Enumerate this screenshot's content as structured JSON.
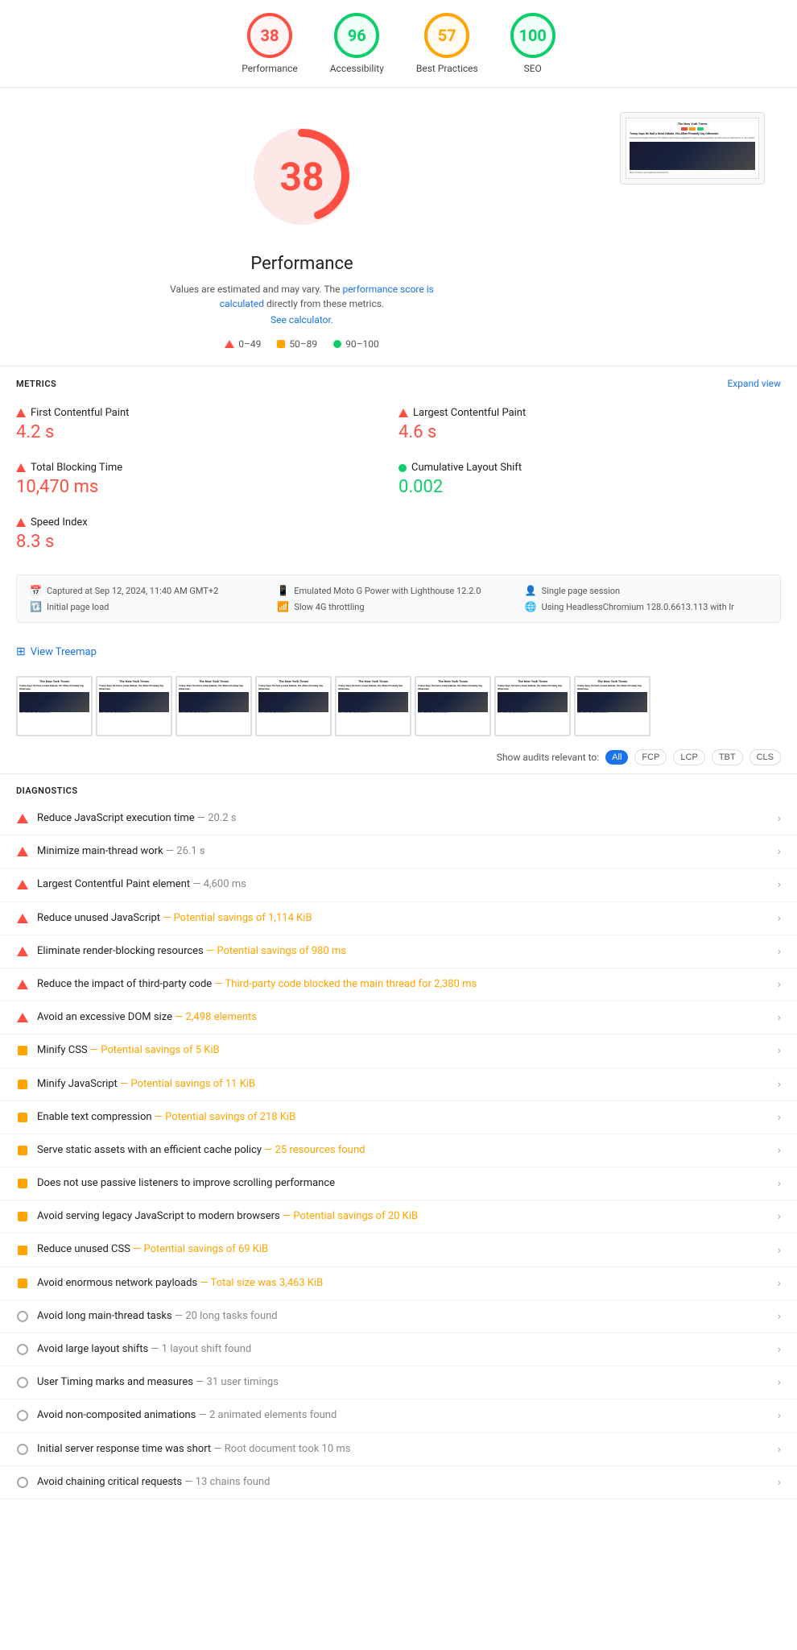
{
  "header": {
    "scores": [
      {
        "id": "performance",
        "value": "38",
        "label": "Performance",
        "colorClass": "red"
      },
      {
        "id": "accessibility",
        "value": "96",
        "label": "Accessibility",
        "colorClass": "green-light"
      },
      {
        "id": "best-practices",
        "value": "57",
        "label": "Best Practices",
        "colorClass": "orange"
      },
      {
        "id": "seo",
        "value": "100",
        "label": "SEO",
        "colorClass": "green"
      }
    ]
  },
  "performance": {
    "score": "38",
    "title": "Performance",
    "description": "Values are estimated and may vary. The",
    "description_link": "performance score is calculated",
    "description_end": "directly from these metrics.",
    "see_calculator": "See calculator.",
    "legend": [
      {
        "type": "triangle",
        "range": "0–49"
      },
      {
        "type": "square",
        "range": "50–89"
      },
      {
        "type": "dot",
        "range": "90–100"
      }
    ]
  },
  "metrics": {
    "title": "METRICS",
    "expand_view": "Expand view",
    "items": [
      {
        "id": "fcp",
        "icon": "triangle",
        "name": "First Contentful Paint",
        "value": "4.2 s",
        "color": "red"
      },
      {
        "id": "lcp",
        "icon": "triangle",
        "name": "Largest Contentful Paint",
        "value": "4.6 s",
        "color": "red"
      },
      {
        "id": "tbt",
        "icon": "triangle",
        "name": "Total Blocking Time",
        "value": "10,470 ms",
        "color": "red"
      },
      {
        "id": "cls",
        "icon": "dot",
        "name": "Cumulative Layout Shift",
        "value": "0.002",
        "color": "green"
      },
      {
        "id": "si",
        "icon": "triangle",
        "name": "Speed Index",
        "value": "8.3 s",
        "color": "red"
      }
    ]
  },
  "info_bar": {
    "items": [
      {
        "icon": "📅",
        "text": "Captured at Sep 12, 2024, 11:40 AM GMT+2"
      },
      {
        "icon": "📱",
        "text": "Emulated Moto G Power with Lighthouse 12.2.0"
      },
      {
        "icon": "👤",
        "text": "Single page session"
      },
      {
        "icon": "🔃",
        "text": "Initial page load"
      },
      {
        "icon": "📶",
        "text": "Slow 4G throttling"
      },
      {
        "icon": "🌐",
        "text": "Using HeadlessChromium 128.0.6613.113 with lr"
      }
    ]
  },
  "treemap": {
    "link": "View Treemap"
  },
  "filter": {
    "label": "Show audits relevant to:",
    "buttons": [
      {
        "label": "All",
        "active": true
      },
      {
        "label": "FCP",
        "active": false
      },
      {
        "label": "LCP",
        "active": false
      },
      {
        "label": "TBT",
        "active": false
      },
      {
        "label": "CLS",
        "active": false
      }
    ]
  },
  "diagnostics": {
    "title": "DIAGNOSTICS",
    "items": [
      {
        "icon": "triangle",
        "text": "Reduce JavaScript execution time",
        "detail": "— 20.2 s",
        "detailColor": "normal"
      },
      {
        "icon": "triangle",
        "text": "Minimize main-thread work",
        "detail": "— 26.1 s",
        "detailColor": "normal"
      },
      {
        "icon": "triangle",
        "text": "Largest Contentful Paint element",
        "detail": "— 4,600 ms",
        "detailColor": "normal"
      },
      {
        "icon": "triangle",
        "text": "Reduce unused JavaScript",
        "detail": "— Potential savings of 1,114 KiB",
        "detailColor": "orange"
      },
      {
        "icon": "triangle",
        "text": "Eliminate render-blocking resources",
        "detail": "— Potential savings of 980 ms",
        "detailColor": "orange"
      },
      {
        "icon": "triangle",
        "text": "Reduce the impact of third-party code",
        "detail": "— Third-party code blocked the main thread for 2,380 ms",
        "detailColor": "orange"
      },
      {
        "icon": "triangle",
        "text": "Avoid an excessive DOM size",
        "detail": "— 2,498 elements",
        "detailColor": "orange"
      },
      {
        "icon": "square",
        "text": "Minify CSS",
        "detail": "— Potential savings of 5 KiB",
        "detailColor": "orange"
      },
      {
        "icon": "square",
        "text": "Minify JavaScript",
        "detail": "— Potential savings of 11 KiB",
        "detailColor": "orange"
      },
      {
        "icon": "square",
        "text": "Enable text compression",
        "detail": "— Potential savings of 218 KiB",
        "detailColor": "orange"
      },
      {
        "icon": "square",
        "text": "Serve static assets with an efficient cache policy",
        "detail": "— 25 resources found",
        "detailColor": "orange"
      },
      {
        "icon": "square",
        "text": "Does not use passive listeners to improve scrolling performance",
        "detail": "",
        "detailColor": "normal"
      },
      {
        "icon": "square",
        "text": "Avoid serving legacy JavaScript to modern browsers",
        "detail": "— Potential savings of 20 KiB",
        "detailColor": "orange"
      },
      {
        "icon": "square",
        "text": "Reduce unused CSS",
        "detail": "— Potential savings of 69 KiB",
        "detailColor": "orange"
      },
      {
        "icon": "square",
        "text": "Avoid enormous network payloads",
        "detail": "— Total size was 3,463 KiB",
        "detailColor": "orange"
      },
      {
        "icon": "circle",
        "text": "Avoid long main-thread tasks",
        "detail": "— 20 long tasks found",
        "detailColor": "normal"
      },
      {
        "icon": "circle",
        "text": "Avoid large layout shifts",
        "detail": "— 1 layout shift found",
        "detailColor": "normal"
      },
      {
        "icon": "circle",
        "text": "User Timing marks and measures",
        "detail": "— 31 user timings",
        "detailColor": "normal"
      },
      {
        "icon": "circle",
        "text": "Avoid non-composited animations",
        "detail": "— 2 animated elements found",
        "detailColor": "normal"
      },
      {
        "icon": "circle",
        "text": "Initial server response time was short",
        "detail": "— Root document took 10 ms",
        "detailColor": "normal"
      },
      {
        "icon": "circle",
        "text": "Avoid chaining critical requests",
        "detail": "— 13 chains found",
        "detailColor": "normal"
      }
    ]
  }
}
